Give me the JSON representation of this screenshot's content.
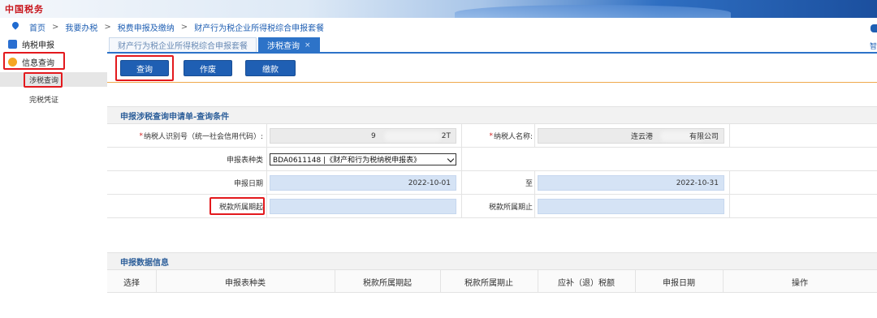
{
  "banner": {
    "logo_text": "中国税务"
  },
  "breadcrumb": {
    "items": [
      "首页",
      "我要办税",
      "税费申报及缴纳",
      "财产行为税企业所得税综合申报套餐"
    ],
    "right_label": "智"
  },
  "sidebar": {
    "items": [
      {
        "label": "纳税申报",
        "icon": "tax-report-icon"
      },
      {
        "label": "信息查询",
        "icon": "info-query-icon"
      }
    ],
    "subitems": [
      "涉税查询",
      "完税凭证"
    ]
  },
  "tabs": [
    {
      "label": "财产行为税企业所得税综合申报套餐",
      "active": false
    },
    {
      "label": "涉税查询",
      "active": true,
      "close": "×"
    }
  ],
  "toolbar": {
    "query": "查询",
    "void": "作废",
    "pay": "缴款"
  },
  "query_panel": {
    "title": "申报涉税查询申请单-查询条件",
    "taxpayer_id_label": "纳税人识别号（统一社会信用代码）:",
    "taxpayer_id_prefix": "9",
    "taxpayer_id_suffix": "2T",
    "taxpayer_name_label": "纳税人名称:",
    "taxpayer_name_prefix": "连云港",
    "taxpayer_name_suffix": "有限公司",
    "form_type_label": "申报表种类",
    "form_type_value": "BDA0611148 |《财产和行为税纳税申报表》",
    "date_label": "申报日期",
    "date_from": "2022-10-01",
    "date_to_label": "至",
    "date_to": "2022-10-31",
    "period_start_label": "税款所属期起",
    "period_end_label": "税款所属期止",
    "required_mark": "*"
  },
  "result_panel": {
    "title": "申报数据信息",
    "columns": [
      "选择",
      "申报表种类",
      "税款所属期起",
      "税款所属期止",
      "应补（退）税额",
      "申报日期",
      "操作"
    ]
  },
  "colors": {
    "primary": "#1f5fb3",
    "highlight": "#e3191d",
    "field_bg": "#d5e3f5"
  }
}
